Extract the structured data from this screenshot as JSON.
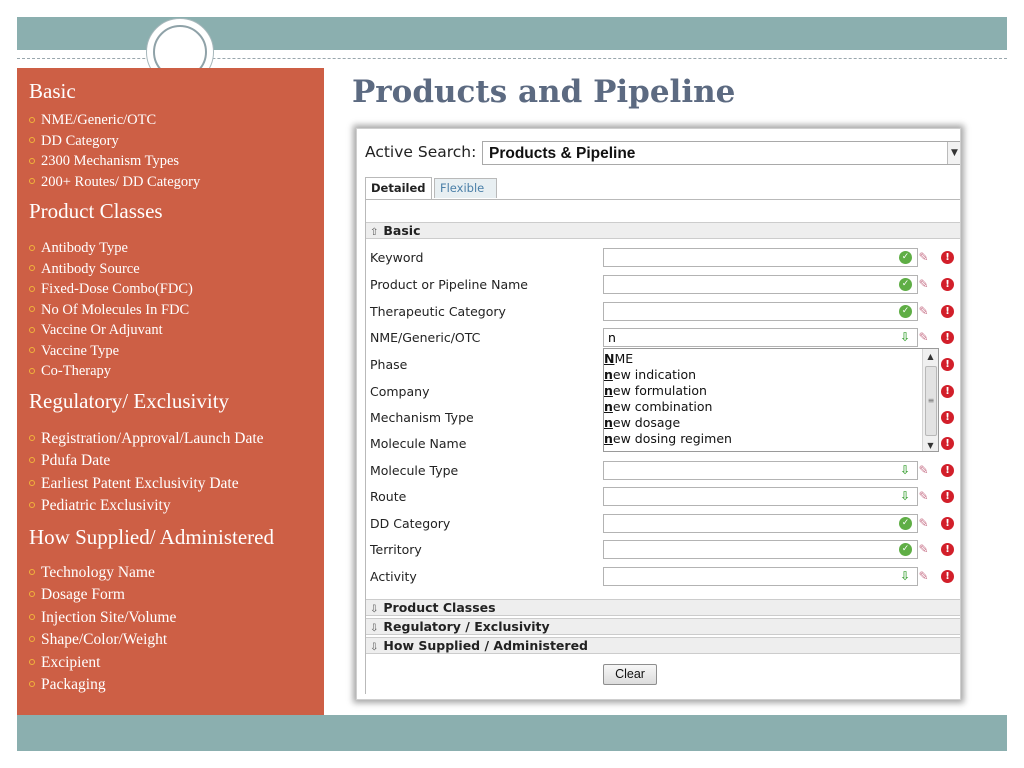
{
  "slide": {
    "title": "Products and Pipeline",
    "colors": {
      "frame": "#8bafaf",
      "panel": "#cd5f45",
      "title": "#5c6a81",
      "bullet": "#f0b33b"
    }
  },
  "left_panel": {
    "sections": [
      {
        "heading": "Basic",
        "items": [
          "NME/Generic/OTC",
          "DD Category",
          "2300 Mechanism Types",
          "200+ Routes/ DD Category"
        ]
      },
      {
        "heading": "Product Classes",
        "items": [
          "Antibody Type",
          "Antibody Source",
          "Fixed-Dose Combo(FDC)",
          "No Of Molecules In FDC",
          "Vaccine Or Adjuvant",
          "Vaccine Type",
          "Co-Therapy"
        ]
      },
      {
        "heading": "Regulatory/ Exclusivity",
        "items": [
          "Registration/Approval/Launch Date",
          "Pdufa Date",
          "Earliest Patent Exclusivity Date",
          "Pediatric Exclusivity"
        ]
      },
      {
        "heading": "How Supplied/ Administered",
        "items": [
          "Technology Name",
          "Dosage Form",
          "Injection Site/Volume",
          "Shape/Color/Weight",
          "Excipient",
          "Packaging"
        ]
      }
    ]
  },
  "app": {
    "active_search_label": "Active Search:",
    "active_search_value": "Products & Pipeline",
    "tabs": [
      "Detailed",
      "Flexible"
    ],
    "sections": {
      "basic": "Basic",
      "product_classes": "Product Classes",
      "regulatory": "Regulatory / Exclusivity",
      "how_supplied": "How Supplied / Administered"
    },
    "fields": [
      {
        "label": "Keyword",
        "value": "",
        "icon": "check-icon"
      },
      {
        "label": "Product or Pipeline Name",
        "value": "",
        "icon": "check-icon"
      },
      {
        "label": "Therapeutic Category",
        "value": "",
        "icon": "check-icon"
      },
      {
        "label": "NME/Generic/OTC",
        "value": "n",
        "icon": "download-icon"
      },
      {
        "label": "Phase",
        "value": "",
        "icon": "none"
      },
      {
        "label": "Company",
        "value": "",
        "icon": "none"
      },
      {
        "label": "Mechanism Type",
        "value": "",
        "icon": "none"
      },
      {
        "label": "Molecule Name",
        "value": "",
        "icon": "none"
      },
      {
        "label": "Molecule Type",
        "value": "",
        "icon": "download-icon"
      },
      {
        "label": "Route",
        "value": "",
        "icon": "download-icon"
      },
      {
        "label": "DD Category",
        "value": "",
        "icon": "check-icon"
      },
      {
        "label": "Territory",
        "value": "",
        "icon": "check-icon"
      },
      {
        "label": "Activity",
        "value": "",
        "icon": "download-icon"
      }
    ],
    "autocomplete": [
      {
        "match": "N",
        "rest": "ME"
      },
      {
        "match": "n",
        "rest": "ew indication"
      },
      {
        "match": "n",
        "rest": "ew formulation"
      },
      {
        "match": "n",
        "rest": "ew combination"
      },
      {
        "match": "n",
        "rest": "ew dosage"
      },
      {
        "match": "n",
        "rest": "ew dosing regimen"
      }
    ],
    "clear_label": "Clear"
  }
}
